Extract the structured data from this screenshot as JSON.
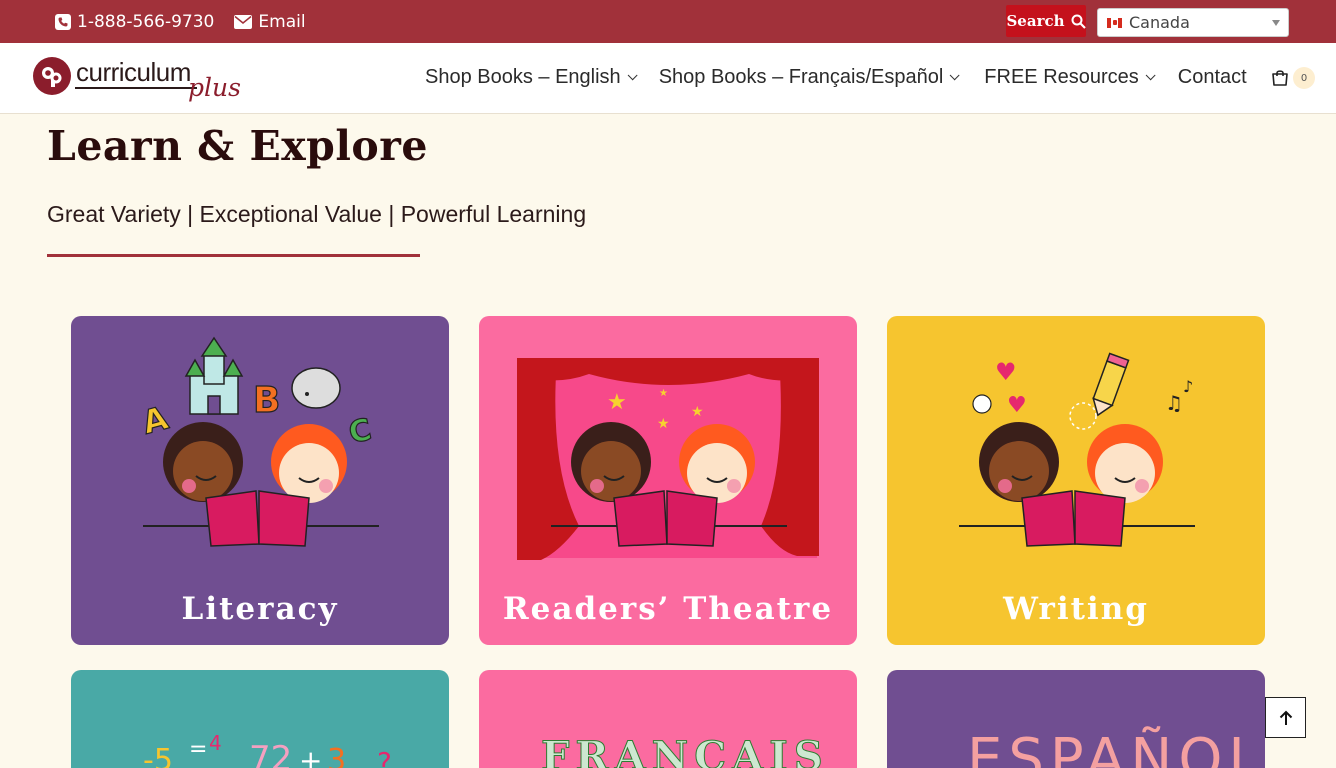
{
  "topbar": {
    "phone": "1-888-566-9730",
    "email": "Email",
    "search_label": "Search",
    "country": "Canada"
  },
  "header": {
    "logo_word": "curriculum",
    "logo_plus": "plus",
    "nav": [
      {
        "label": "Shop Books – English",
        "has_menu": true
      },
      {
        "label": "Shop Books – Français/Español",
        "has_menu": true
      },
      {
        "label": "FREE Resources",
        "has_menu": true
      },
      {
        "label": "Contact",
        "has_menu": false
      }
    ],
    "cart_count": "0"
  },
  "intro": {
    "title": "Learn & Explore",
    "tagline": "Great Variety | Exceptional Value | Powerful Learning"
  },
  "cards": [
    {
      "label": "Literacy",
      "color": "#704e91"
    },
    {
      "label": "Readers’ Theatre",
      "color": "#fb6ba0"
    },
    {
      "label": "Writing",
      "color": "#f6c52f"
    },
    {
      "label": "",
      "color": "#49a9a6"
    },
    {
      "label": "",
      "color": "#fb6ba0"
    },
    {
      "label": "",
      "color": "#704e91"
    }
  ],
  "colors": {
    "topbar": "#a1313a",
    "accent": "#c4111c",
    "background": "#fdf9ec"
  }
}
